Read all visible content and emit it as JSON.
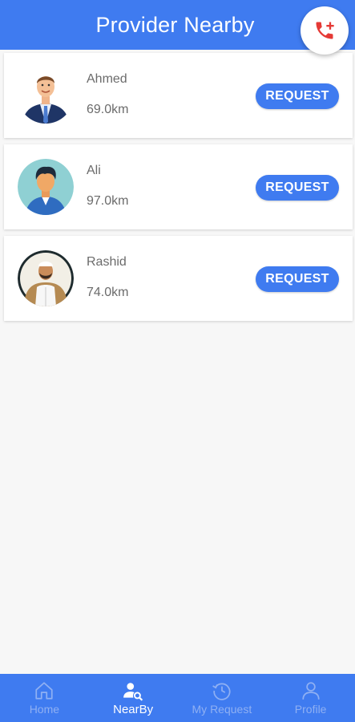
{
  "header": {
    "title": "Provider Nearby"
  },
  "providers": [
    {
      "name": "Ahmed",
      "distance": "69.0km",
      "button": "REQUEST"
    },
    {
      "name": "Ali",
      "distance": "97.0km",
      "button": "REQUEST"
    },
    {
      "name": "Rashid",
      "distance": "74.0km",
      "button": "REQUEST"
    }
  ],
  "bottom_nav": {
    "items": [
      {
        "label": "Home",
        "icon": "home-icon",
        "active": false
      },
      {
        "label": "NearBy",
        "icon": "nearby-search-icon",
        "active": true
      },
      {
        "label": "My Request",
        "icon": "history-icon",
        "active": false
      },
      {
        "label": "Profile",
        "icon": "profile-icon",
        "active": false
      }
    ]
  },
  "colors": {
    "primary": "#3f7bf0",
    "call_icon": "#e53935",
    "text_muted": "#6b6b6b",
    "nav_inactive": "#8fb0f3"
  }
}
